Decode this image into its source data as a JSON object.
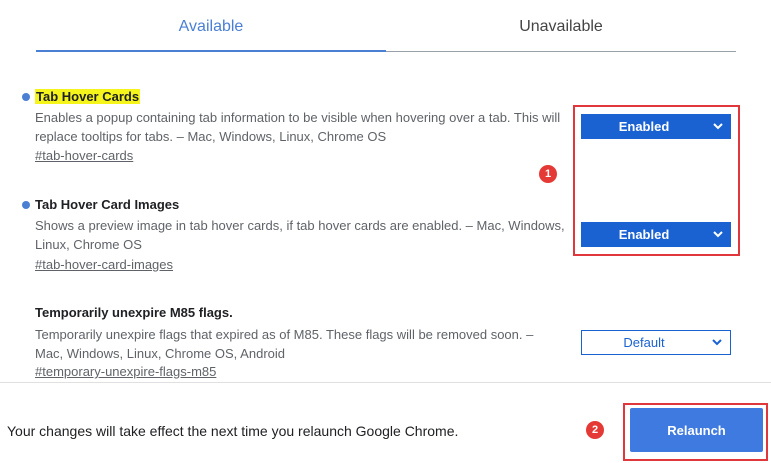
{
  "tabs": [
    {
      "label": "Available",
      "active": true
    },
    {
      "label": "Unavailable",
      "active": false
    }
  ],
  "flags": [
    {
      "title": "Tab Hover Cards",
      "highlighted": true,
      "description": "Enables a popup containing tab information to be visible when hovering over a tab. This will replace tooltips for tabs. – Mac, Windows, Linux, Chrome OS",
      "link": "#tab-hover-cards",
      "value": "Enabled",
      "modified": true
    },
    {
      "title": "Tab Hover Card Images",
      "highlighted": false,
      "description": "Shows a preview image in tab hover cards, if tab hover cards are enabled. – Mac, Windows, Linux, Chrome OS",
      "link": "#tab-hover-card-images",
      "value": "Enabled",
      "modified": true
    },
    {
      "title": "Temporarily unexpire M85 flags.",
      "highlighted": false,
      "description": "Temporarily unexpire flags that expired as of M85. These flags will be removed soon. – Mac, Windows, Linux, Chrome OS, Android",
      "link": "#temporary-unexpire-flags-m85",
      "value": "Default",
      "modified": false
    }
  ],
  "annotations": {
    "badge1": "1",
    "badge2": "2"
  },
  "footer": {
    "message": "Your changes will take effect the next time you relaunch Google Chrome.",
    "relaunch_label": "Relaunch"
  },
  "colors": {
    "accent": "#1a62d2",
    "annotation_red": "#e0373d",
    "highlight": "#f5f51c"
  }
}
